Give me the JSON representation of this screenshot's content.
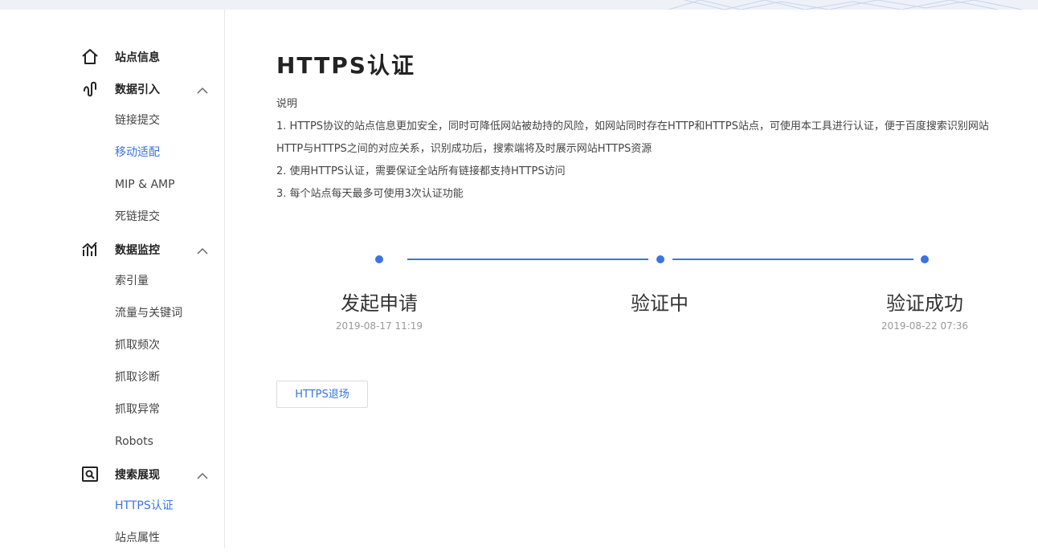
{
  "sidebar": {
    "groups": [
      {
        "label": "站点信息",
        "icon": "home-icon"
      },
      {
        "label": "数据引入",
        "icon": "data-import-icon"
      },
      {
        "label": "数据监控",
        "icon": "data-monitor-icon"
      },
      {
        "label": "搜索展现",
        "icon": "search-display-icon"
      }
    ],
    "items": [
      {
        "label": "链接提交"
      },
      {
        "label": "移动适配"
      },
      {
        "label": "MIP & AMP"
      },
      {
        "label": "死链提交"
      },
      {
        "label": "索引量"
      },
      {
        "label": "流量与关键词"
      },
      {
        "label": "抓取频次"
      },
      {
        "label": "抓取诊断"
      },
      {
        "label": "抓取异常"
      },
      {
        "label": "Robots"
      },
      {
        "label": "HTTPS认证"
      },
      {
        "label": "站点属性"
      }
    ]
  },
  "main": {
    "title": "HTTPS认证",
    "description": {
      "heading": "说明",
      "lines": [
        "1. HTTPS协议的站点信息更加安全，同时可降低网站被劫持的风险，如网站同时存在HTTP和HTTPS站点，可使用本工具进行认证，便于百度搜索识别网站",
        "HTTP与HTTPS之间的对应关系，识别成功后，搜索端将及时展示网站HTTPS资源",
        "2. 使用HTTPS认证，需要保证全站所有链接都支持HTTPS访问",
        "3. 每个站点每天最多可使用3次认证功能"
      ]
    },
    "steps": [
      {
        "title": "发起申请",
        "time": "2019-08-17 11:19"
      },
      {
        "title": "验证中",
        "time": ""
      },
      {
        "title": "验证成功",
        "time": "2019-08-22 07:36"
      }
    ],
    "exit_button": "HTTPS退场"
  },
  "colors": {
    "accent": "#3b74e0",
    "text": "#333333",
    "muted": "#999999"
  }
}
